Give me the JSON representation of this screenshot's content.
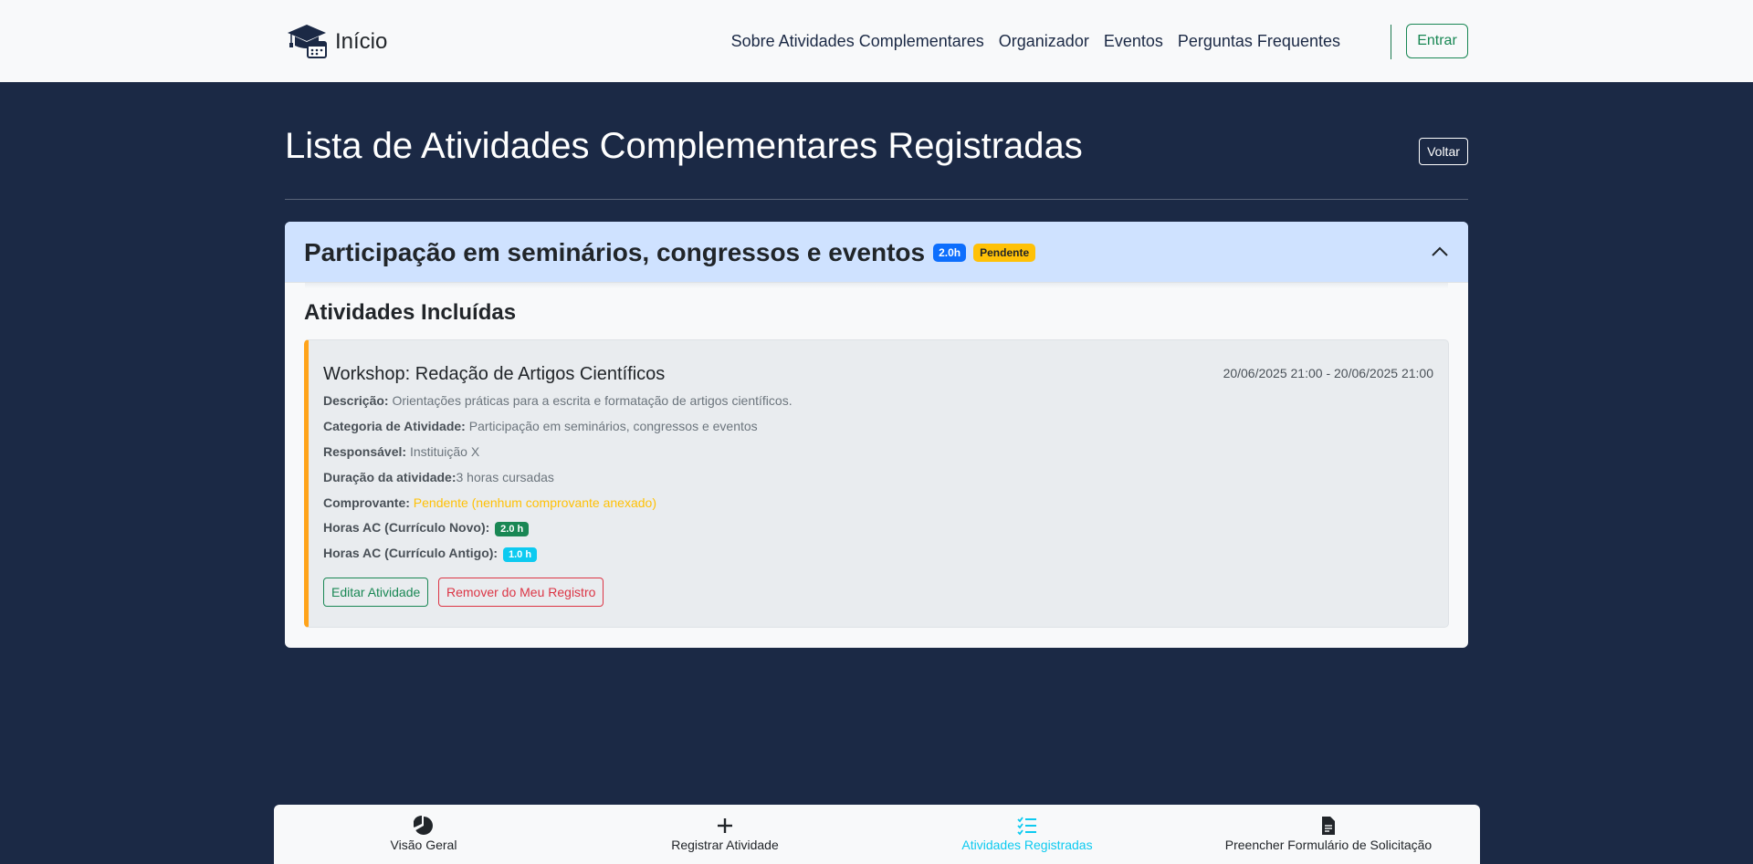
{
  "navbar": {
    "brand": "Início",
    "links": [
      "Sobre Atividades Complementares",
      "Organizador",
      "Eventos",
      "Perguntas Frequentes"
    ],
    "login_label": "Entrar"
  },
  "header": {
    "title": "Lista de Atividades Complementares Registradas",
    "back_label": "Voltar"
  },
  "category": {
    "title": "Participação em seminários, congressos e eventos",
    "hours_badge": "2.0h",
    "status_badge": "Pendente",
    "section_title": "Atividades Incluídas"
  },
  "activity": {
    "title": "Workshop: Redação de Artigos Científicos",
    "date_range": "20/06/2025 21:00 - 20/06/2025 21:00",
    "description_label": "Descrição:",
    "description": "Orientações práticas para a escrita e formatação de artigos científicos.",
    "category_label": "Categoria de Atividade:",
    "category": "Participação em seminários, congressos e eventos",
    "responsible_label": "Responsável:",
    "responsible": "Instituição X",
    "duration_label": "Duração da atividade:",
    "duration": "3 horas cursadas",
    "proof_label": "Comprovante:",
    "proof": "Pendente (nenhum comprovante anexado)",
    "hours_new_label": "Horas AC (Currículo Novo):",
    "hours_new": "2.0 h",
    "hours_old_label": "Horas AC (Currículo Antigo):",
    "hours_old": "1.0 h",
    "edit_label": "Editar Atividade",
    "remove_label": "Remover do Meu Registro"
  },
  "bottom_nav": [
    {
      "label": "Visão Geral",
      "icon": "pie-chart-icon"
    },
    {
      "label": "Registrar Atividade",
      "icon": "plus-icon"
    },
    {
      "label": "Atividades Registradas",
      "icon": "checklist-icon",
      "active": true
    },
    {
      "label": "Preencher Formulário de Solicitação",
      "icon": "document-icon"
    }
  ],
  "colors": {
    "background": "#1b2945",
    "accent_warning": "#ffa41b",
    "active_nav": "#0dcaf0",
    "header_bg": "#cfe2ff"
  }
}
